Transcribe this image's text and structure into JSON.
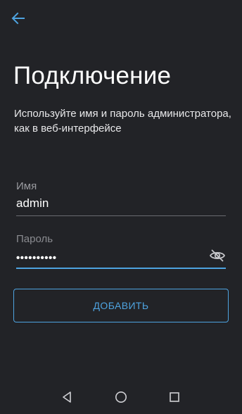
{
  "header": {
    "back_icon": "arrow-left-icon",
    "title": "Подключение",
    "subtitle": "Используйте имя и пароль администратора, как в веб-интерфейсе"
  },
  "form": {
    "username": {
      "label": "Имя",
      "value": "admin"
    },
    "password": {
      "label": "Пароль",
      "value": "••••••••••",
      "toggle_icon": "eye-off-icon"
    },
    "add_button_label": "ДОБАВИТЬ"
  },
  "nav": {
    "back_icon": "triangle-back-icon",
    "home_icon": "circle-home-icon",
    "recents_icon": "square-recents-icon"
  },
  "colors": {
    "background": "#222327",
    "accent": "#4ea3e0",
    "text": "#ffffff",
    "muted": "#9a9ba0"
  }
}
